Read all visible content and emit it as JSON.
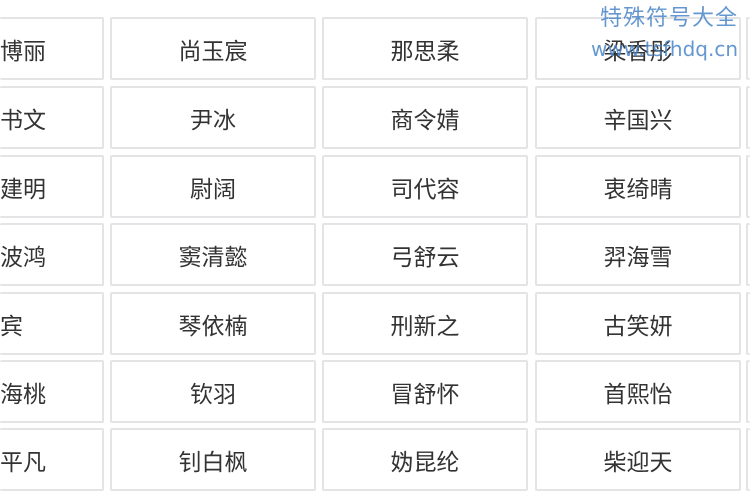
{
  "watermark": {
    "line1": "特殊符号大全",
    "line2": "www.tsfhdq.cn"
  },
  "rows": [
    [
      "博丽",
      "尚玉宸",
      "那思柔",
      "梁香彤"
    ],
    [
      "书文",
      "尹冰",
      "商令婧",
      "辛国兴"
    ],
    [
      "建明",
      "尉阔",
      "司代容",
      "衷绮晴"
    ],
    [
      "波鸿",
      "窦清懿",
      "弓舒云",
      "羿海雪"
    ],
    [
      "宾",
      "琴依楠",
      "刑新之",
      "古笑妍"
    ],
    [
      "海桃",
      "钦羽",
      "冒舒怀",
      "首熙怡"
    ],
    [
      "平凡",
      "钊白枫",
      "妫昆纶",
      "柴迎天"
    ]
  ]
}
